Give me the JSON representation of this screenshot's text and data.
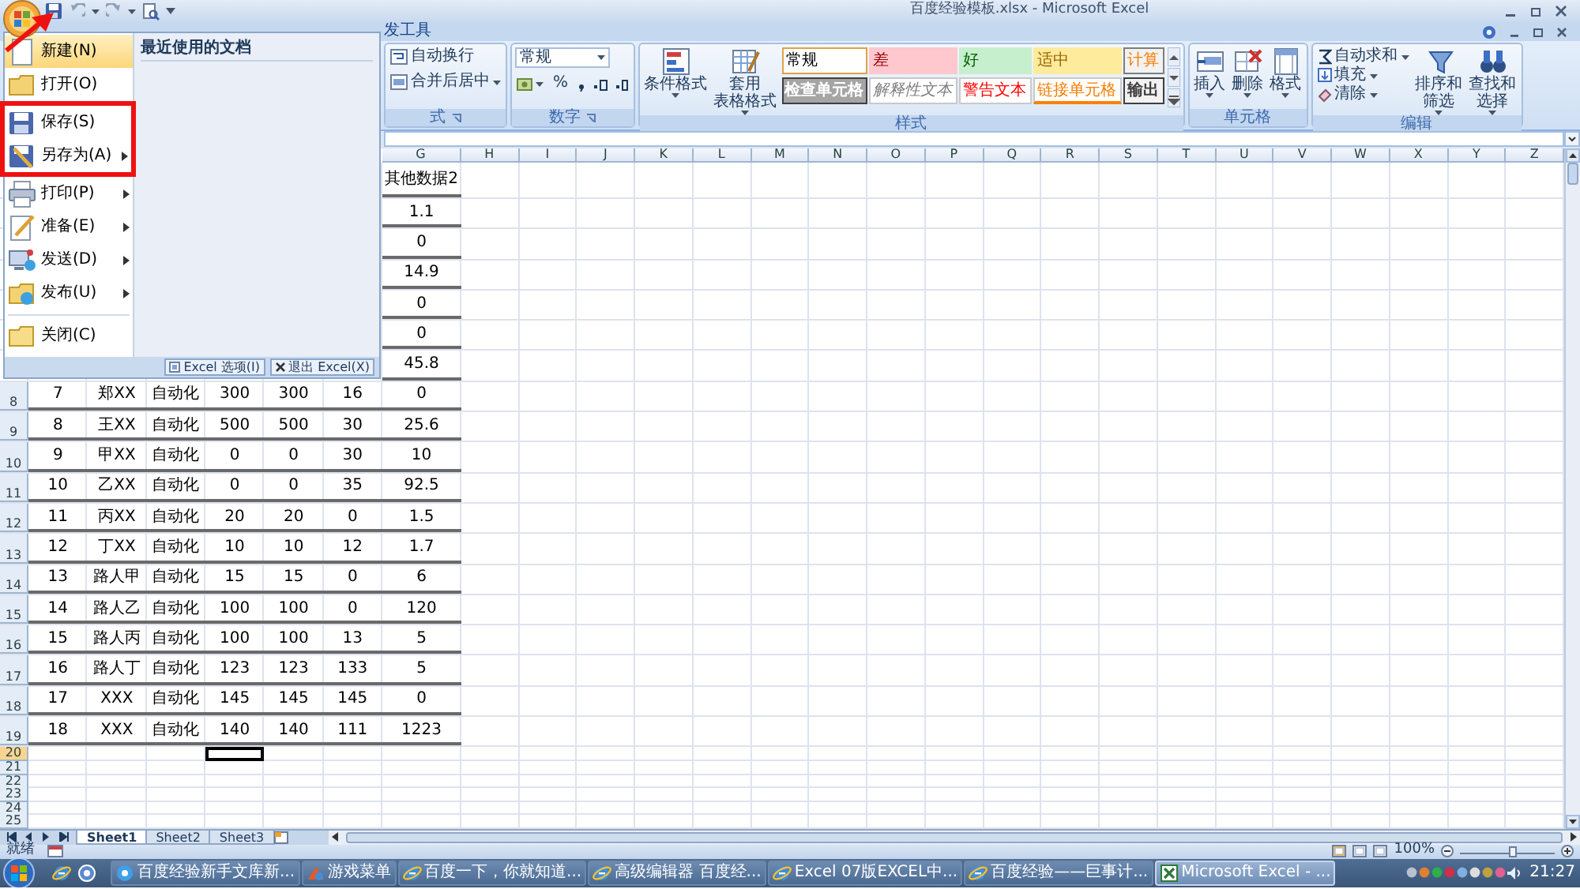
{
  "window": {
    "title": "百度经验模板.xlsx - Microsoft Excel"
  },
  "ribbon": {
    "tab": "发工具",
    "alignment": {
      "buttons": [
        "自动换行",
        "合并后居中"
      ],
      "label": "式"
    },
    "number": {
      "format": "常规",
      "buttons": [
        "%"
      ],
      "label": "数字"
    },
    "styles": {
      "buttons": [
        {
          "lines": [
            "条件格式"
          ],
          "kind": "conditional"
        },
        {
          "lines": [
            "套用",
            "表格格式"
          ],
          "kind": "table"
        }
      ],
      "cell_styles": [
        {
          "text": "常规",
          "kind": "normal"
        },
        {
          "text": "差",
          "kind": "bad"
        },
        {
          "text": "好",
          "kind": "good"
        },
        {
          "text": "适中",
          "kind": "neutral"
        },
        {
          "text": "计算",
          "kind": "calculation"
        },
        {
          "text": "检查单元格",
          "kind": "check"
        },
        {
          "text": "解释性文本",
          "kind": "explanatory"
        },
        {
          "text": "警告文本",
          "kind": "warning"
        },
        {
          "text": "链接单元格",
          "kind": "linked"
        },
        {
          "text": "输出",
          "kind": "output"
        }
      ],
      "label": "样式"
    },
    "cells": {
      "buttons": [
        {
          "text": "插入",
          "kind": "insert"
        },
        {
          "text": "删除",
          "kind": "delete"
        },
        {
          "text": "格式",
          "kind": "format"
        }
      ],
      "label": "单元格"
    },
    "editing": {
      "small_buttons": [
        {
          "text": "自动求和",
          "kind": "sum"
        },
        {
          "text": "填充",
          "kind": "fill"
        },
        {
          "text": "清除",
          "kind": "clear"
        }
      ],
      "large_buttons": [
        {
          "lines": [
            "排序和",
            "筛选"
          ],
          "kind": "sort"
        },
        {
          "lines": [
            "查找和",
            "选择"
          ],
          "kind": "find"
        }
      ],
      "label": "编辑"
    }
  },
  "sheet": {
    "columns": [
      "",
      "",
      "",
      "",
      "",
      "",
      "G",
      "H",
      "I",
      "J",
      "K",
      "L",
      "M",
      "N",
      "O",
      "P",
      "Q",
      "R",
      "S",
      "T",
      "U",
      "V",
      "W",
      "X",
      "Y",
      "Z"
    ],
    "rows": [
      {
        "cells": [
          "",
          "",
          "",
          "",
          "",
          "",
          "其他数据2"
        ]
      },
      {
        "cells": [
          "",
          "",
          "",
          "",
          "",
          "",
          "1.1"
        ]
      },
      {
        "cells": [
          "",
          "",
          "",
          "",
          "",
          "",
          "0"
        ]
      },
      {
        "cells": [
          "",
          "",
          "",
          "",
          "",
          "",
          "14.9"
        ]
      },
      {
        "cells": [
          "",
          "",
          "",
          "",
          "",
          "",
          "0"
        ]
      },
      {
        "cells": [
          "",
          "",
          "",
          "",
          "",
          "",
          "0"
        ]
      },
      {
        "cells": [
          "",
          "",
          "",
          "",
          "",
          "",
          "45.8"
        ]
      },
      {
        "number": "8",
        "cells": [
          "7",
          "郑XX",
          "自动化",
          "300",
          "300",
          "16",
          "0"
        ]
      },
      {
        "number": "9",
        "cells": [
          "8",
          "王XX",
          "自动化",
          "500",
          "500",
          "30",
          "25.6"
        ]
      },
      {
        "number": "10",
        "cells": [
          "9",
          "甲XX",
          "自动化",
          "0",
          "0",
          "30",
          "10"
        ]
      },
      {
        "number": "11",
        "cells": [
          "10",
          "乙XX",
          "自动化",
          "0",
          "0",
          "35",
          "92.5"
        ]
      },
      {
        "number": "12",
        "cells": [
          "11",
          "丙XX",
          "自动化",
          "20",
          "20",
          "0",
          "1.5"
        ]
      },
      {
        "number": "13",
        "cells": [
          "12",
          "丁XX",
          "自动化",
          "10",
          "10",
          "12",
          "1.7"
        ]
      },
      {
        "number": "14",
        "cells": [
          "13",
          "路人甲",
          "自动化",
          "15",
          "15",
          "0",
          "6"
        ]
      },
      {
        "number": "15",
        "cells": [
          "14",
          "路人乙",
          "自动化",
          "100",
          "100",
          "0",
          "120"
        ]
      },
      {
        "number": "16",
        "cells": [
          "15",
          "路人丙",
          "自动化",
          "100",
          "100",
          "13",
          "5"
        ]
      },
      {
        "number": "17",
        "cells": [
          "16",
          "路人丁",
          "自动化",
          "123",
          "123",
          "133",
          "5"
        ]
      },
      {
        "number": "18",
        "cells": [
          "17",
          "XXX",
          "自动化",
          "145",
          "145",
          "145",
          "0"
        ]
      },
      {
        "number": "19",
        "cells": [
          "18",
          "XXX",
          "自动化",
          "140",
          "140",
          "111",
          "1223"
        ]
      }
    ],
    "empty_rows": [
      {
        "number": "20",
        "selected": true,
        "cells": [
          {
            "selected": false
          },
          {
            "selected": false
          },
          {
            "selected": false
          },
          {
            "selected": true
          }
        ]
      },
      {
        "number": "21",
        "selected": false
      },
      {
        "number": "22",
        "selected": false
      },
      {
        "number": "23",
        "selected": false
      },
      {
        "number": "24",
        "selected": false
      },
      {
        "number": "25",
        "selected": false
      }
    ]
  },
  "sheet_tabs": [
    {
      "text": "Sheet1",
      "selected": true
    },
    {
      "text": "Sheet2",
      "selected": false
    },
    {
      "text": "Sheet3",
      "selected": false
    }
  ],
  "status_bar": {
    "text": "就绪",
    "zoom": "100%",
    "level": 0.55
  },
  "office_menu": {
    "items": [
      {
        "text": "新建(N)",
        "kind": "new",
        "selected": true,
        "submenu": false,
        "boxed": false
      },
      {
        "text": "打开(O)",
        "kind": "open",
        "selected": false,
        "submenu": false,
        "boxed": false
      },
      {
        "text": "保存(S)",
        "kind": "save",
        "selected": false,
        "submenu": false,
        "boxed": true
      },
      {
        "text": "另存为(A)",
        "kind": "saveas",
        "selected": false,
        "submenu": true,
        "boxed": true
      },
      {
        "text": "打印(P)",
        "kind": "print",
        "selected": false,
        "submenu": true,
        "boxed": false
      },
      {
        "text": "准备(E)",
        "kind": "prepare",
        "selected": false,
        "submenu": true,
        "boxed": false
      },
      {
        "text": "发送(D)",
        "kind": "send",
        "selected": false,
        "submenu": true,
        "boxed": false
      },
      {
        "text": "发布(U)",
        "kind": "publish",
        "selected": false,
        "submenu": true,
        "boxed": false
      },
      {
        "text": "关闭(C)",
        "kind": "close",
        "selected": false,
        "submenu": false,
        "boxed": false
      }
    ],
    "recent_title": "最近使用的文档",
    "buttons": [
      {
        "text": "Excel 选项(I)",
        "kind": "options"
      },
      {
        "text": "退出 Excel(X)",
        "kind": "exit"
      }
    ]
  },
  "annotations": [
    {
      "kind": "arrow"
    }
  ],
  "taskbar": {
    "tasks": [
      {
        "text": "百度经验新手文库新...",
        "kind": "browser",
        "selected": false
      },
      {
        "text": "游戏菜单",
        "kind": "game",
        "selected": false
      },
      {
        "text": "百度一下，你就知道...",
        "kind": "ie",
        "selected": false
      },
      {
        "text": "高级编辑器 百度经...",
        "kind": "ie",
        "selected": false
      },
      {
        "text": "Excel 07版EXCEL中...",
        "kind": "ie",
        "selected": false
      },
      {
        "text": "百度经验——巨事计...",
        "kind": "ie",
        "selected": false
      },
      {
        "text": "Microsoft Excel - ...",
        "kind": "excel",
        "selected": true
      }
    ],
    "clock": "21:27"
  }
}
